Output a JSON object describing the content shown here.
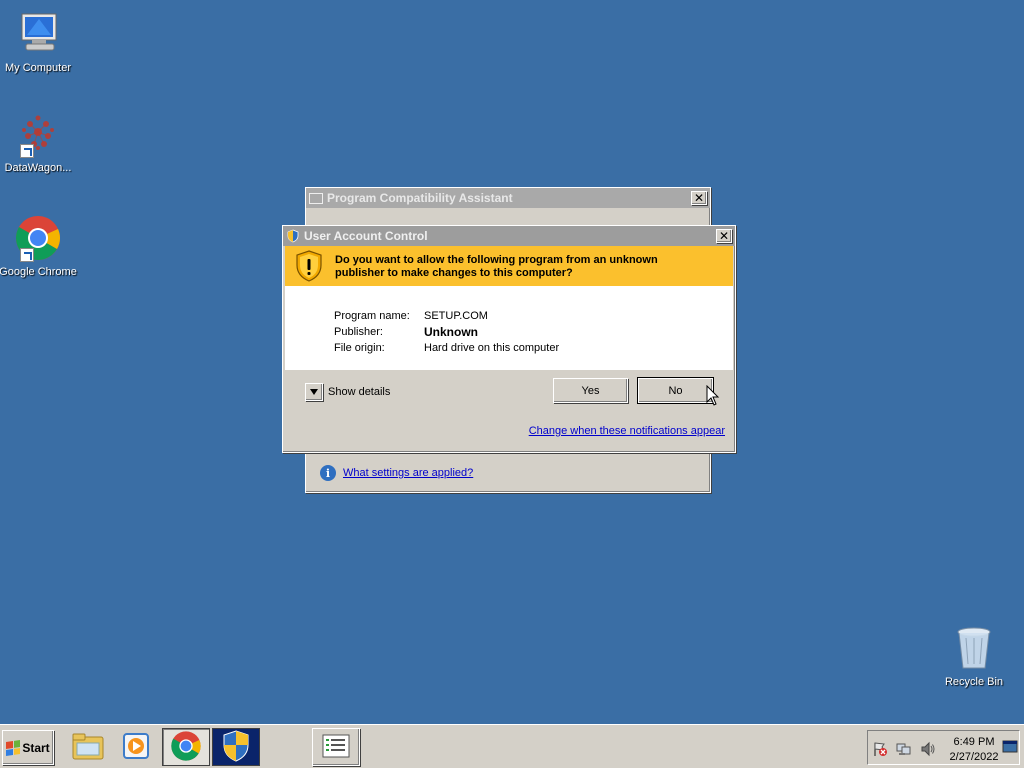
{
  "desktop": {
    "icons": [
      {
        "label": "My Computer",
        "icon": "computer-icon"
      },
      {
        "label": "DataWagon...",
        "icon": "datawagon-icon"
      },
      {
        "label": "Google Chrome",
        "icon": "chrome-icon"
      },
      {
        "label": "Recycle Bin",
        "icon": "recycle-bin-icon"
      }
    ]
  },
  "pca_window": {
    "title": "Program Compatibility Assistant",
    "close": "✕",
    "settings_link": "What settings are applied?"
  },
  "uac_window": {
    "title": "User Account Control",
    "close": "✕",
    "prompt": "Do you want to allow the following program from an unknown publisher to make changes to this computer?",
    "fields": [
      {
        "label": "Program name:",
        "value": "SETUP.COM"
      },
      {
        "label": "Publisher:",
        "value": "Unknown"
      },
      {
        "label": "File origin:",
        "value": "Hard drive on this computer"
      }
    ],
    "show_details": "Show details",
    "yes_label": "Yes",
    "no_label": "No",
    "change_link": "Change when these notifications appear"
  },
  "taskbar": {
    "start_label": "Start",
    "time": "6:49 PM",
    "date": "2/27/2022"
  },
  "colors": {
    "desktop": "#3a6ea5",
    "banner": "#fbc02d",
    "link": "#0000cc"
  }
}
